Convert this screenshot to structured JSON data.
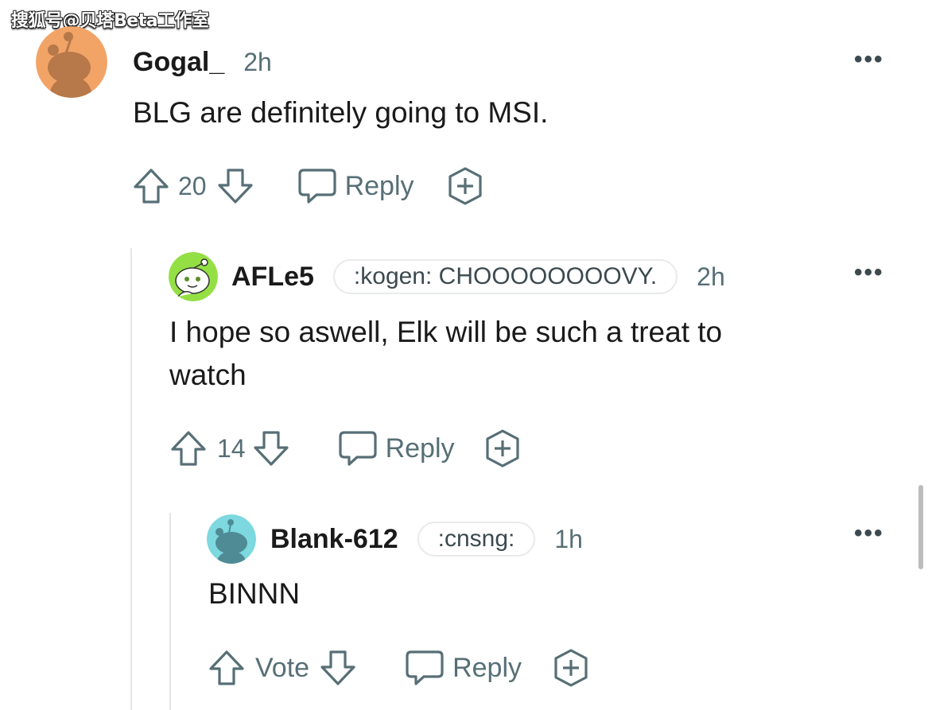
{
  "watermark": "搜狐号@贝塔Beta工作室",
  "comments": [
    {
      "username": "Gogal_",
      "time": "2h",
      "body": "BLG are definitely going to MSI.",
      "score": "20",
      "reply_label": "Reply",
      "avatar_color": "#f2a467"
    },
    {
      "username": "AFLe5",
      "flair": ":kogen: CHOOOOOOOOVY.",
      "time": "2h",
      "body_line1": "I hope so aswell, Elk will be such a treat to",
      "body_line2": "watch",
      "score": "14",
      "reply_label": "Reply",
      "avatar_color": "#94e044"
    },
    {
      "username": "Blank-612",
      "flair": ":cnsng:",
      "time": "1h",
      "body": "BINNN",
      "score": "Vote",
      "reply_label": "Reply",
      "avatar_color": "#7dd8df"
    }
  ],
  "more_icon": "•••"
}
